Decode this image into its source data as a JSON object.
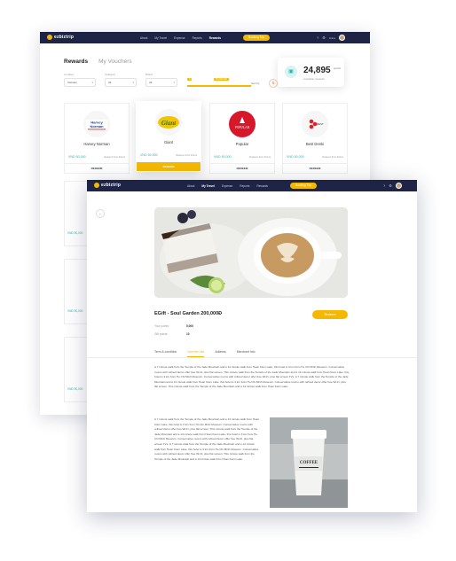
{
  "brand": {
    "name": "ezbiztrip"
  },
  "back": {
    "nav": [
      "About",
      "My Travel",
      "Expense",
      "Reports",
      "Rewards"
    ],
    "cta": "Booking Trip",
    "user": "Anna",
    "tabs": [
      "Rewards",
      "My Vouchers"
    ],
    "filters": [
      {
        "label": "Location",
        "value": "Vietnam"
      },
      {
        "label": "Category",
        "value": "All"
      },
      {
        "label": "Brand",
        "value": "All"
      }
    ],
    "range": {
      "min": "0",
      "max": "50,000,000"
    },
    "sort_label": "Sort by",
    "points": {
      "value": "24,895",
      "unit": "points",
      "sub": "Available rewards"
    },
    "cards": [
      {
        "name": "Harvey Norman",
        "logo": "Harvey Norman",
        "price": "VND 50,000",
        "note": "Redeem from Points",
        "button": "REDEEM"
      },
      {
        "name": "Giant",
        "logo": "Giant",
        "price": "VND 50,000",
        "note": "Redeem from Points",
        "button": "REDEEM"
      },
      {
        "name": "Popular",
        "logo": "POPULAR",
        "price": "VND 50,000",
        "note": "Redeem from Points",
        "button": "REDEEM"
      },
      {
        "name": "Best Denki",
        "logo": "BEST DENKI",
        "price": "VND 50,000",
        "note": "Redeem from Points",
        "button": "REDEEM"
      }
    ],
    "stubs": [
      {
        "price": "VND 50,000"
      },
      {
        "price": "VND 50,000",
        "label": "Ha"
      },
      {
        "price": "VND 50,000"
      }
    ]
  },
  "front": {
    "nav": [
      "About",
      "My Travel",
      "Expense",
      "Reports",
      "Rewards"
    ],
    "cta": "Booking Trip",
    "title": "EGift - Soul Garden 200,000Đ",
    "redeem": "Redeem",
    "your_points_label": "Your points:",
    "your_points": "5,000",
    "gift_points_label": "Gift points:",
    "gift_points": "10",
    "tabs": [
      "Term & condition",
      "Voucher Info",
      "Address",
      "Merchant Info"
    ],
    "desc1": "A 7 minute walk from the Temple of the Jade Mountain and a 14 minute walk from Hoan Kiem Lake, this hotel is 3 km from Ho Chi Minh Museum. Conservative rooms with refined decor offer free Wi-Fi, plus flat screen. This minute walk from the Temple of the Jade Mountain and a 14 minute walk from Hoan Kiem Lake, this hotel is 3 km from Ho Chi Minh Museum. Conservative rooms with refined decor offer free Wi-Fi, plus flat screen TVs. A 7 minute walk from the Temple of the Jade Mountain and a 14 minute walk from Hoan Kiem Lake, this hotel is 3 km from Ho Chi Minh Museum. Conservative rooms with refined decor offer free Wi-Fi, plus flat screen. This minute walk from the Temple of the Jade Mountain and a 14 minute walk from Hoan Kiem Lake.",
    "desc2": "A 7 minute walk from the Temple of the Jade Mountain and a 14 minute walk from Hoan Kiem Lake, this hotel is 3 km from Ho Chi Minh Museum. Conservative rooms with refined decor offer free Wi-Fi, plus flat screen. This minute walk from the Temple of the Jade Mountain and a 14 minute walk from Hoan Kiem Lake, this hotel is 3 km from Ho Chi Minh Museum. Conservative rooms with refined decor offer free Wi-Fi, plus flat screen TVs. A 7 minute walk from the Temple of the Jade Mountain and a 14 minute walk from Hoan Kiem Lake, this hotel is 3 km from Ho Chi Minh Museum. Conservative rooms with refined decor offer free Wi-Fi, plus flat screen. This minute walk from the Temple of the Jade Mountain and a 14 minute walk from Hoan Kiem Lake."
  },
  "colors": {
    "navy": "#1e2446",
    "accent": "#f5b800",
    "teal": "#2bb5ad"
  }
}
